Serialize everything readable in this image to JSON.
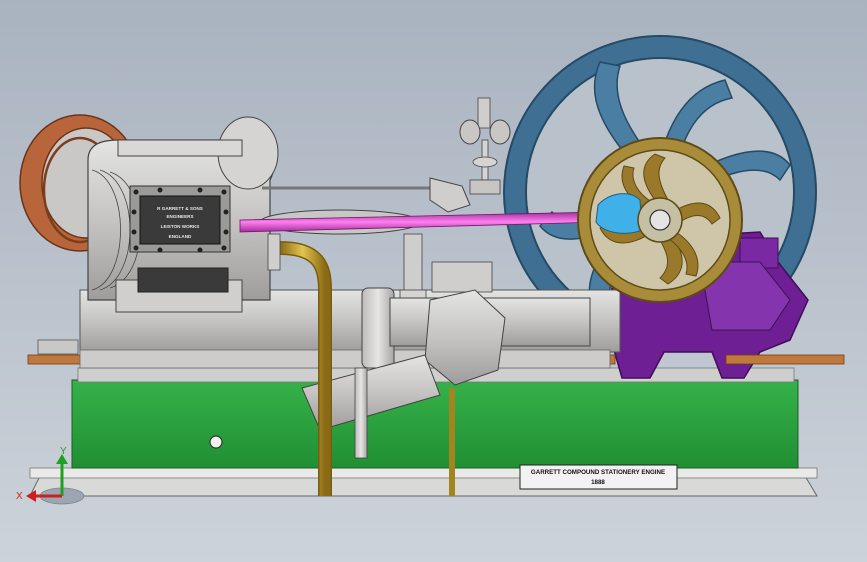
{
  "nameplate": {
    "line1": "R GARRETT & SONS",
    "line2": "ENGINEERS",
    "line3": "LEISTON WORKS",
    "line4": "ENGLAND"
  },
  "label_plate": {
    "title": "GARRETT COMPOUND STATIONERY ENGINE",
    "year": "1888"
  },
  "triad": {
    "x_label": "X",
    "y_label": "Y"
  },
  "colors": {
    "flywheel": "#3f6f93",
    "small_wheel": "#a98c3a",
    "purple_frame": "#6e1f93",
    "base": "#2aa33e",
    "copper_pipe": "#c8a634",
    "heat_disc": "#b8653b",
    "platform": "#c0783c",
    "axis_x": "#cc2020",
    "axis_y": "#20a020"
  }
}
